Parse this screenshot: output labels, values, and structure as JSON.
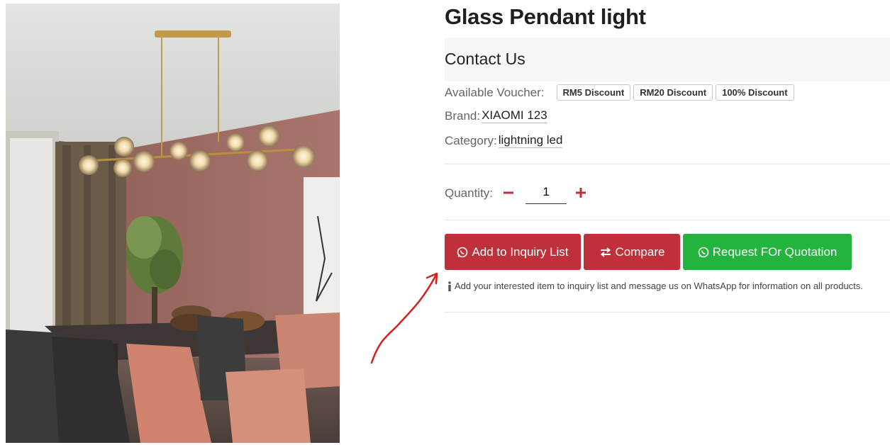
{
  "product": {
    "title": "Glass Pendant light",
    "image_alt": "pendant-light-dining-room-photo"
  },
  "contact": {
    "label": "Contact Us"
  },
  "vouchers": {
    "label": "Available Voucher:",
    "items": [
      "RM5 Discount",
      "RM20 Discount",
      "100% Discount"
    ]
  },
  "brand": {
    "label": "Brand:",
    "value": "XIAOMI 123"
  },
  "category": {
    "label": "Category:",
    "value": "lightning led"
  },
  "quantity": {
    "label": "Quantity:",
    "value": "1",
    "minus_icon": "minus-icon",
    "plus_icon": "plus-icon"
  },
  "actions": {
    "inquiry_label": "Add to Inquiry List",
    "compare_label": "Compare",
    "quotation_label": "Request FOr Quotation",
    "inquiry_icon": "whatsapp-icon",
    "compare_icon": "exchange-icon",
    "quotation_icon": "whatsapp-icon"
  },
  "note": {
    "icon": "info-icon",
    "text": "Add your interested item to inquiry list and message us on WhatsApp for information on all products."
  },
  "colors": {
    "accent_red": "#c0303a",
    "accent_green": "#22b43c",
    "annotation_arrow": "#d42020"
  }
}
